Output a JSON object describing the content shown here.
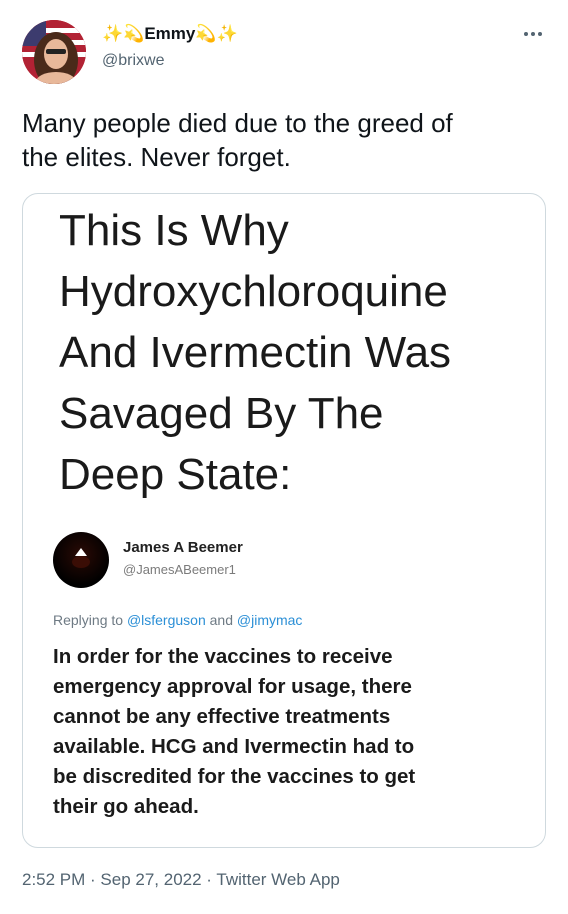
{
  "author": {
    "display_name": "✨💫Emmy💫✨",
    "handle": "@brixwe"
  },
  "tweet": {
    "text_line1": "Many people died due to the greed of",
    "text_line2": "the elites. Never forget."
  },
  "image": {
    "headline_lines": [
      "This Is Why",
      "Hydroxychloroquine",
      "And Ivermectin Was",
      "Savaged By The",
      "Deep State:"
    ],
    "quoted": {
      "name": "James A Beemer",
      "handle": "@JamesABeemer1",
      "replying_prefix": "Replying to ",
      "replying_user1": "@lsferguson",
      "replying_and": " and ",
      "replying_user2": "@jimymac",
      "body_lines": [
        "In order for the vaccines to receive",
        "emergency approval for usage, there",
        "cannot be any effective treatments",
        "available. HCG and Ivermectin had to",
        "be discredited for the vaccines to get",
        "their go ahead."
      ]
    }
  },
  "meta": {
    "time": "2:52 PM",
    "sep": " · ",
    "date": "Sep 27, 2022",
    "source": "Twitter Web App"
  },
  "icons": {
    "more": "more-icon"
  }
}
